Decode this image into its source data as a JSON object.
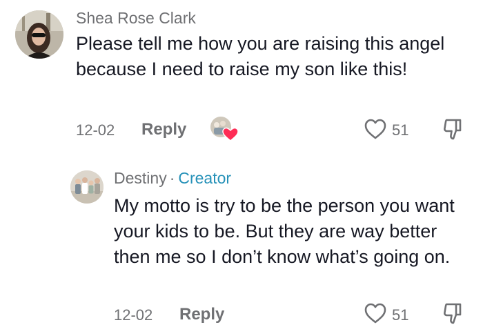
{
  "comments": [
    {
      "author": "Shea Rose Clark",
      "text": "Please tell me how you are raising this angel because I need to raise my son like this!",
      "date": "12-02",
      "reply_label": "Reply",
      "likes": "51"
    },
    {
      "author": "Destiny",
      "separator": "·",
      "badge": "Creator",
      "text": "My motto is try to be the person you want your kids to be. But they are way better then me so I don’t know what’s going on.",
      "date": "12-02",
      "reply_label": "Reply",
      "likes": "51"
    }
  ],
  "colors": {
    "text": "#161823",
    "muted": "#6f7073",
    "creator_badge": "#2591b8",
    "heart": "#fe2c55"
  },
  "icons": [
    "heart-outline-icon",
    "thumbs-down-icon",
    "creator-liked-heart-icon"
  ]
}
